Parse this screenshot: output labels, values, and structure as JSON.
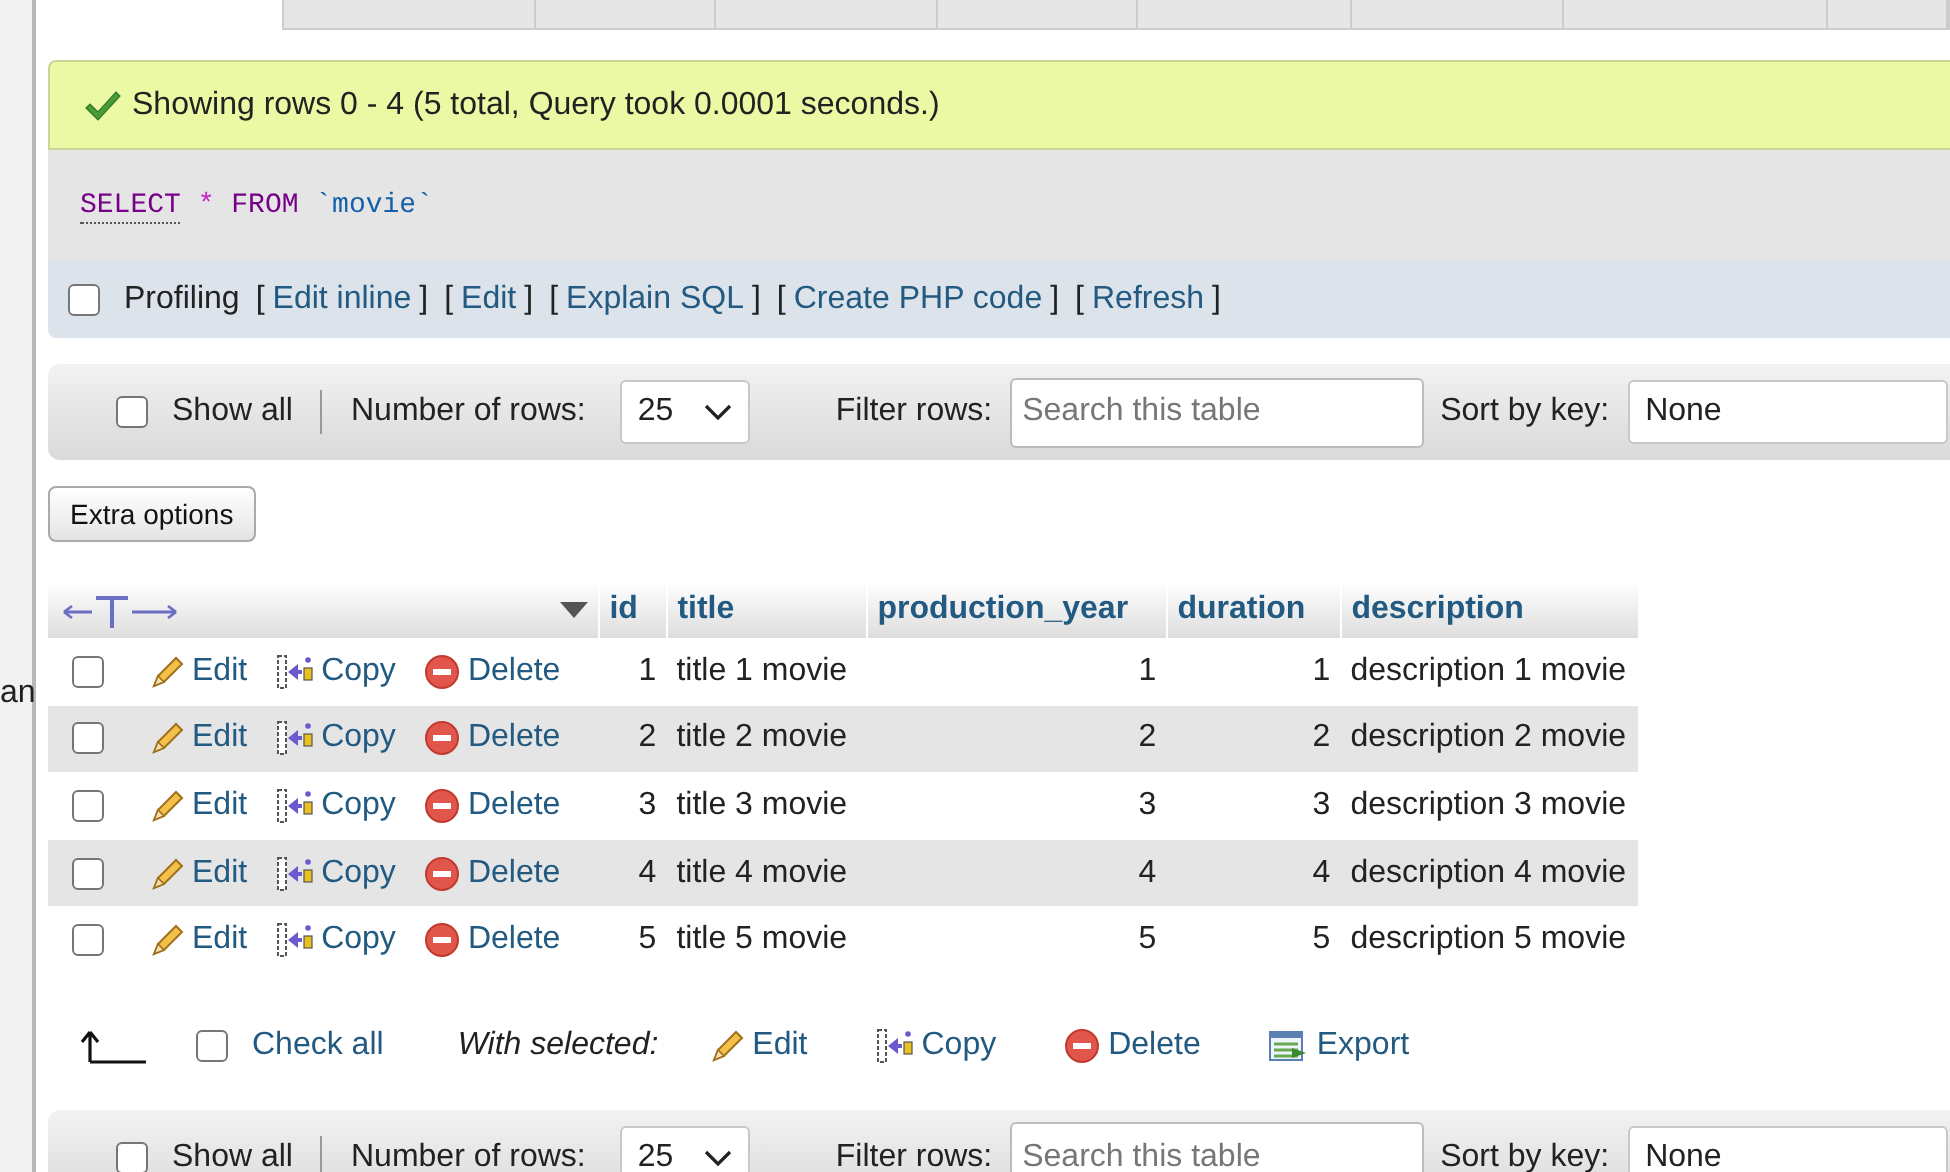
{
  "sidebar": {
    "text": "an"
  },
  "message": {
    "text": "Showing rows 0 - 4 (5 total, Query took 0.0001 seconds.)"
  },
  "sql": [
    {
      "text": "SELECT",
      "kind": "keyword"
    },
    {
      "text": "*",
      "kind": "operator"
    },
    {
      "text": "FROM",
      "kind": "keyword"
    },
    {
      "text": "`movie`",
      "kind": "identifier"
    }
  ],
  "profiling": {
    "label": "Profiling",
    "checked": false,
    "open_bracket": "[",
    "close_bracket": "]",
    "links": [
      "Edit inline",
      "Edit",
      "Explain SQL",
      "Create PHP code",
      "Refresh"
    ]
  },
  "navigation_bars": [
    {
      "show_all": {
        "label": "Show all",
        "checked": false
      },
      "rows_label": "Number of rows:",
      "rows_value": "25",
      "filter_label": "Filter rows:",
      "filter_placeholder": "Search this table",
      "sort_label": "Sort by key:",
      "sort_value": "None"
    },
    {
      "show_all": {
        "label": "Show all",
        "checked": false
      },
      "rows_label": "Number of rows:",
      "rows_value": "25",
      "filter_label": "Filter rows:",
      "filter_placeholder": "Search this table",
      "sort_label": "Sort by key:",
      "sort_value": "None"
    }
  ],
  "extra_options": {
    "label": "Extra options"
  },
  "table": {
    "columns": [
      {
        "label": "id",
        "kind": "number"
      },
      {
        "label": "title",
        "kind": "text"
      },
      {
        "label": "production_year",
        "kind": "number"
      },
      {
        "label": "duration",
        "kind": "number"
      },
      {
        "label": "description",
        "kind": "text"
      }
    ],
    "rows": [
      {
        "checked": false,
        "actions": [
          {
            "kind": "edit",
            "label": "Edit"
          },
          {
            "kind": "copy",
            "label": "Copy"
          },
          {
            "kind": "delete",
            "label": "Delete"
          }
        ],
        "cells": [
          "1",
          "title 1 movie",
          "1",
          "1",
          "description 1 movie"
        ]
      },
      {
        "checked": false,
        "actions": [
          {
            "kind": "edit",
            "label": "Edit"
          },
          {
            "kind": "copy",
            "label": "Copy"
          },
          {
            "kind": "delete",
            "label": "Delete"
          }
        ],
        "cells": [
          "2",
          "title 2 movie",
          "2",
          "2",
          "description 2 movie"
        ]
      },
      {
        "checked": false,
        "actions": [
          {
            "kind": "edit",
            "label": "Edit"
          },
          {
            "kind": "copy",
            "label": "Copy"
          },
          {
            "kind": "delete",
            "label": "Delete"
          }
        ],
        "cells": [
          "3",
          "title 3 movie",
          "3",
          "3",
          "description 3 movie"
        ]
      },
      {
        "checked": false,
        "actions": [
          {
            "kind": "edit",
            "label": "Edit"
          },
          {
            "kind": "copy",
            "label": "Copy"
          },
          {
            "kind": "delete",
            "label": "Delete"
          }
        ],
        "cells": [
          "4",
          "title 4 movie",
          "4",
          "4",
          "description 4 movie"
        ]
      },
      {
        "checked": false,
        "actions": [
          {
            "kind": "edit",
            "label": "Edit"
          },
          {
            "kind": "copy",
            "label": "Copy"
          },
          {
            "kind": "delete",
            "label": "Delete"
          }
        ],
        "cells": [
          "5",
          "title 5 movie",
          "5",
          "5",
          "description 5 movie"
        ]
      }
    ]
  },
  "bulk_actions": {
    "check_all": {
      "label": "Check all",
      "checked": false
    },
    "with_selected": "With selected:",
    "actions": [
      {
        "kind": "edit",
        "label": "Edit"
      },
      {
        "kind": "copy",
        "label": "Copy"
      },
      {
        "kind": "delete",
        "label": "Delete"
      },
      {
        "kind": "export",
        "label": "Export"
      }
    ]
  }
}
